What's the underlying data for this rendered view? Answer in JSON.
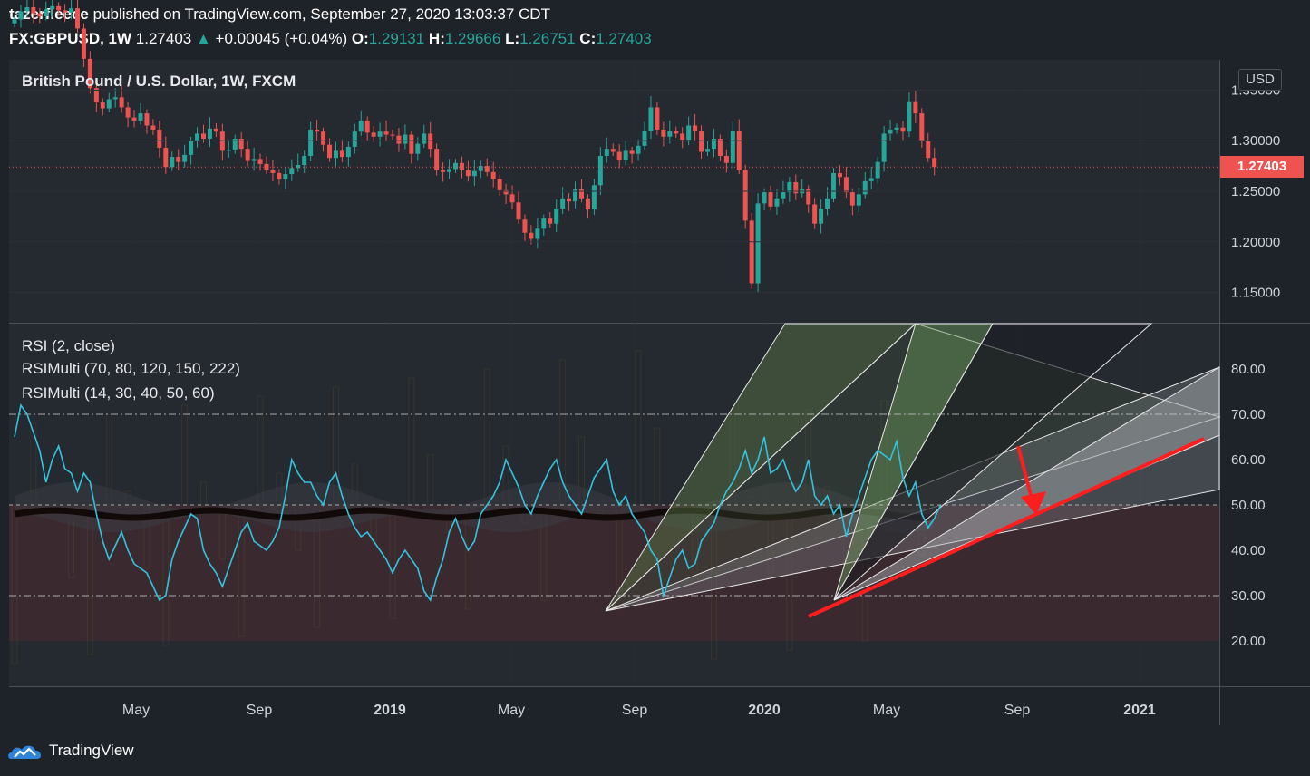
{
  "header": {
    "author": "tazerfleece",
    "published_text": "published on TradingView.com, September 27, 2020 13:03:37 CDT",
    "symbol": "FX:GBPUSD, 1W",
    "last": "1.27403",
    "arrow": "▲",
    "change": "+0.00045 (+0.04%)",
    "o_label": "O:",
    "o": "1.29131",
    "h_label": "H:",
    "h": "1.29666",
    "l_label": "L:",
    "l": "1.26751",
    "c_label": "C:",
    "c": "1.27403"
  },
  "main_pane": {
    "title": "British Pound / U.S. Dollar, 1W, FXCM",
    "currency_button": "USD",
    "last_price_tag": "1.27403"
  },
  "indicators": [
    "RSI (2, close)",
    "RSIMulti (70, 80, 120, 150, 222)",
    "RSIMulti (14, 30, 40, 50, 60)"
  ],
  "branding": {
    "name": "TradingView",
    "icon": "tradingview-cloud-logo"
  },
  "colors": {
    "background": "#1e2229",
    "up": "#26a69a",
    "down": "#ef5350",
    "rsi_line": "#33c3e0",
    "annotation": "#ff1e1e",
    "grid": "#2c3038"
  },
  "chart_data": [
    {
      "type": "candlestick",
      "title": "British Pound / U.S. Dollar, 1W, FXCM",
      "ylim": [
        1.12,
        1.38
      ],
      "y_ticks": [
        "1.35000",
        "1.30000",
        "1.25000",
        "1.20000",
        "1.15000"
      ],
      "x_ticks": [
        "May",
        "Sep",
        "2019",
        "May",
        "Sep",
        "2020",
        "May",
        "Sep",
        "2021"
      ],
      "last_price": 1.27403,
      "series": [
        {
          "close": 1.42
        },
        {
          "close": 1.428
        },
        {
          "close": 1.432
        },
        {
          "close": 1.426
        },
        {
          "close": 1.423
        },
        {
          "close": 1.43
        },
        {
          "close": 1.433
        },
        {
          "close": 1.429
        },
        {
          "close": 1.427
        },
        {
          "close": 1.431
        },
        {
          "close": 1.411
        },
        {
          "close": 1.381
        },
        {
          "close": 1.352
        },
        {
          "close": 1.338
        },
        {
          "close": 1.332
        },
        {
          "close": 1.341
        },
        {
          "close": 1.343
        },
        {
          "close": 1.333
        },
        {
          "close": 1.323
        },
        {
          "close": 1.32
        },
        {
          "close": 1.327
        },
        {
          "close": 1.315
        },
        {
          "close": 1.311
        },
        {
          "close": 1.293
        },
        {
          "close": 1.274
        },
        {
          "close": 1.284
        },
        {
          "close": 1.279
        },
        {
          "close": 1.286
        },
        {
          "close": 1.3
        },
        {
          "close": 1.307
        },
        {
          "close": 1.302
        },
        {
          "close": 1.312
        },
        {
          "close": 1.309
        },
        {
          "close": 1.29
        },
        {
          "close": 1.291
        },
        {
          "close": 1.302
        },
        {
          "close": 1.292
        },
        {
          "close": 1.28
        },
        {
          "close": 1.282
        },
        {
          "close": 1.277
        },
        {
          "close": 1.271
        },
        {
          "close": 1.268
        },
        {
          "close": 1.262
        },
        {
          "close": 1.267
        },
        {
          "close": 1.273
        },
        {
          "close": 1.276
        },
        {
          "close": 1.285
        },
        {
          "close": 1.311
        },
        {
          "close": 1.309
        },
        {
          "close": 1.296
        },
        {
          "close": 1.283
        },
        {
          "close": 1.29
        },
        {
          "close": 1.284
        },
        {
          "close": 1.294
        },
        {
          "close": 1.309
        },
        {
          "close": 1.32
        },
        {
          "close": 1.308
        },
        {
          "close": 1.304
        },
        {
          "close": 1.309
        },
        {
          "close": 1.306
        },
        {
          "close": 1.305
        },
        {
          "close": 1.297
        },
        {
          "close": 1.306
        },
        {
          "close": 1.287
        },
        {
          "close": 1.297
        },
        {
          "close": 1.307
        },
        {
          "close": 1.292
        },
        {
          "close": 1.271
        },
        {
          "close": 1.269
        },
        {
          "close": 1.272
        },
        {
          "close": 1.278
        },
        {
          "close": 1.271
        },
        {
          "close": 1.265
        },
        {
          "close": 1.27
        },
        {
          "close": 1.275
        },
        {
          "close": 1.269
        },
        {
          "close": 1.262
        },
        {
          "close": 1.251
        },
        {
          "close": 1.247
        },
        {
          "close": 1.239
        },
        {
          "close": 1.222
        },
        {
          "close": 1.209
        },
        {
          "close": 1.203
        },
        {
          "close": 1.213
        },
        {
          "close": 1.223
        },
        {
          "close": 1.218
        },
        {
          "close": 1.233
        },
        {
          "close": 1.243
        },
        {
          "close": 1.24
        },
        {
          "close": 1.252
        },
        {
          "close": 1.243
        },
        {
          "close": 1.232
        },
        {
          "close": 1.256
        },
        {
          "close": 1.285
        },
        {
          "close": 1.292
        },
        {
          "close": 1.289
        },
        {
          "close": 1.281
        },
        {
          "close": 1.29
        },
        {
          "close": 1.287
        },
        {
          "close": 1.295
        },
        {
          "close": 1.31
        },
        {
          "close": 1.333
        },
        {
          "close": 1.311
        },
        {
          "close": 1.304
        },
        {
          "close": 1.31
        },
        {
          "close": 1.307
        },
        {
          "close": 1.301
        },
        {
          "close": 1.315
        },
        {
          "close": 1.31
        },
        {
          "close": 1.289
        },
        {
          "close": 1.292
        },
        {
          "close": 1.302
        },
        {
          "close": 1.285
        },
        {
          "close": 1.278
        },
        {
          "close": 1.31
        },
        {
          "close": 1.271
        },
        {
          "close": 1.221
        },
        {
          "close": 1.159
        },
        {
          "close": 1.238
        },
        {
          "close": 1.249
        },
        {
          "close": 1.235
        },
        {
          "close": 1.243
        },
        {
          "close": 1.249
        },
        {
          "close": 1.259
        },
        {
          "close": 1.248
        },
        {
          "close": 1.252
        },
        {
          "close": 1.237
        },
        {
          "close": 1.218
        },
        {
          "close": 1.233
        },
        {
          "close": 1.243
        },
        {
          "close": 1.268
        },
        {
          "close": 1.264
        },
        {
          "close": 1.249
        },
        {
          "close": 1.236
        },
        {
          "close": 1.247
        },
        {
          "close": 1.26
        },
        {
          "close": 1.263
        },
        {
          "close": 1.279
        },
        {
          "close": 1.307
        },
        {
          "close": 1.311
        },
        {
          "close": 1.313
        },
        {
          "close": 1.309
        },
        {
          "close": 1.339
        },
        {
          "close": 1.327
        },
        {
          "close": 1.3
        },
        {
          "close": 1.283
        },
        {
          "close": 1.274
        }
      ]
    },
    {
      "type": "line",
      "title": "RSI (2, close)",
      "ylim": [
        10,
        90
      ],
      "y_ticks": [
        "80.00",
        "70.00",
        "60.00",
        "50.00",
        "40.00",
        "30.00",
        "20.00"
      ],
      "levels": [
        70,
        50,
        30
      ],
      "band": [
        20,
        50
      ],
      "series": [
        {
          "values": [
            65,
            72,
            70,
            66,
            62,
            55,
            60,
            63,
            58,
            57,
            53,
            57,
            55,
            48,
            42,
            38,
            41,
            44,
            40,
            37,
            36,
            35,
            32,
            29,
            30,
            38,
            42,
            45,
            48,
            47,
            40,
            37,
            35,
            32,
            36,
            40,
            44,
            46,
            42,
            41,
            40,
            42,
            45,
            52,
            60,
            57,
            55,
            55,
            52,
            50,
            55,
            57,
            52,
            48,
            45,
            43,
            44,
            42,
            40,
            38,
            35,
            38,
            40,
            38,
            36,
            31,
            29,
            34,
            38,
            44,
            47,
            43,
            40,
            42,
            48,
            50,
            52,
            55,
            60,
            57,
            54,
            50,
            48,
            52,
            55,
            58,
            60,
            55,
            52,
            50,
            48,
            52,
            56,
            58,
            60,
            53,
            50,
            52,
            48,
            46,
            44,
            40,
            38,
            30,
            34,
            38,
            40,
            36,
            37,
            42,
            44,
            46,
            50,
            53,
            55,
            58,
            62,
            57,
            60,
            65,
            57,
            58,
            60,
            56,
            53,
            55,
            60,
            52,
            50,
            52,
            48,
            50,
            43,
            48,
            52,
            56,
            60,
            62,
            61,
            60,
            64,
            56,
            52,
            55,
            48,
            45,
            47,
            50
          ]
        }
      ],
      "annotations": [
        "red support trendline from RSI lows",
        "red arrow pointing down to trendline"
      ]
    }
  ]
}
